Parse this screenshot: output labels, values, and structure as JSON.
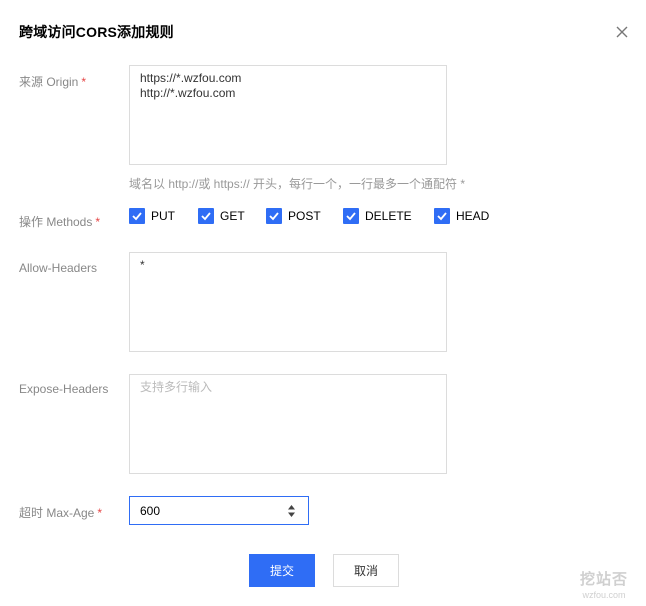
{
  "dialog": {
    "title": "跨域访问CORS添加规则"
  },
  "form": {
    "origin": {
      "label": "来源 Origin",
      "required_mark": "*",
      "value": "https://*.wzfou.com\nhttp://*.wzfou.com",
      "hint": "域名以 http://或 https:// 开头，每行一个，一行最多一个通配符 *"
    },
    "methods": {
      "label": "操作 Methods",
      "required_mark": "*",
      "options": [
        {
          "label": "PUT",
          "checked": true
        },
        {
          "label": "GET",
          "checked": true
        },
        {
          "label": "POST",
          "checked": true
        },
        {
          "label": "DELETE",
          "checked": true
        },
        {
          "label": "HEAD",
          "checked": true
        }
      ]
    },
    "allow_headers": {
      "label": "Allow-Headers",
      "value": "*"
    },
    "expose_headers": {
      "label": "Expose-Headers",
      "value": "",
      "placeholder": "支持多行输入"
    },
    "max_age": {
      "label": "超时 Max-Age",
      "required_mark": "*",
      "value": "600"
    }
  },
  "buttons": {
    "submit": "提交",
    "cancel": "取消"
  },
  "watermark": {
    "top": "挖站否",
    "bottom": "wzfou.com"
  },
  "colors": {
    "primary": "#2f6df5",
    "required": "#e54545"
  }
}
